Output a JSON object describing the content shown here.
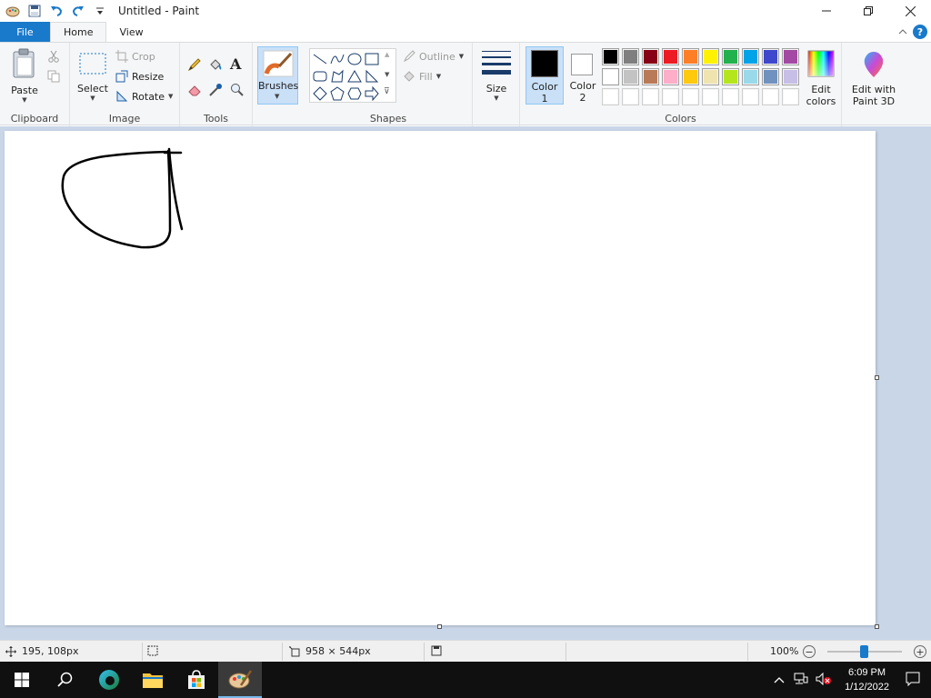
{
  "window": {
    "title": "Untitled - Paint"
  },
  "tabs": [
    {
      "label": "File"
    },
    {
      "label": "Home"
    },
    {
      "label": "View"
    }
  ],
  "ribbon": {
    "clipboard": {
      "paste_label": "Paste",
      "group_label": "Clipboard"
    },
    "image": {
      "select_label": "Select",
      "crop_label": "Crop",
      "resize_label": "Resize",
      "rotate_label": "Rotate",
      "group_label": "Image"
    },
    "tools": {
      "group_label": "Tools"
    },
    "brushes": {
      "label": "Brushes"
    },
    "shapes": {
      "outline_label": "Outline",
      "fill_label": "Fill",
      "group_label": "Shapes"
    },
    "size": {
      "label": "Size"
    },
    "colors": {
      "color1_label": "Color 1",
      "color1_line1": "Color",
      "color1_line2": "1",
      "color2_line1": "Color",
      "color2_line2": "2",
      "edit_line1": "Edit",
      "edit_line2": "colors",
      "group_label": "Colors",
      "color1_value": "#000000",
      "color2_value": "#ffffff",
      "palette_row1": [
        "#000000",
        "#7f7f7f",
        "#880015",
        "#ed1c24",
        "#ff7f27",
        "#fff200",
        "#22b14c",
        "#00a2e8",
        "#3f48cc",
        "#a349a4"
      ],
      "palette_row2": [
        "#ffffff",
        "#c3c3c3",
        "#b97a57",
        "#ffaec9",
        "#ffc90e",
        "#efe4b0",
        "#b5e61d",
        "#99d9ea",
        "#7092be",
        "#c8bfe7"
      ]
    },
    "paint3d": {
      "line1": "Edit with",
      "line2": "Paint 3D"
    }
  },
  "status": {
    "cursor_pos": "195, 108px",
    "canvas_size": "958 × 544px",
    "zoom": "100%"
  },
  "taskbar": {
    "time": "6:09 PM",
    "date": "1/12/2022"
  }
}
